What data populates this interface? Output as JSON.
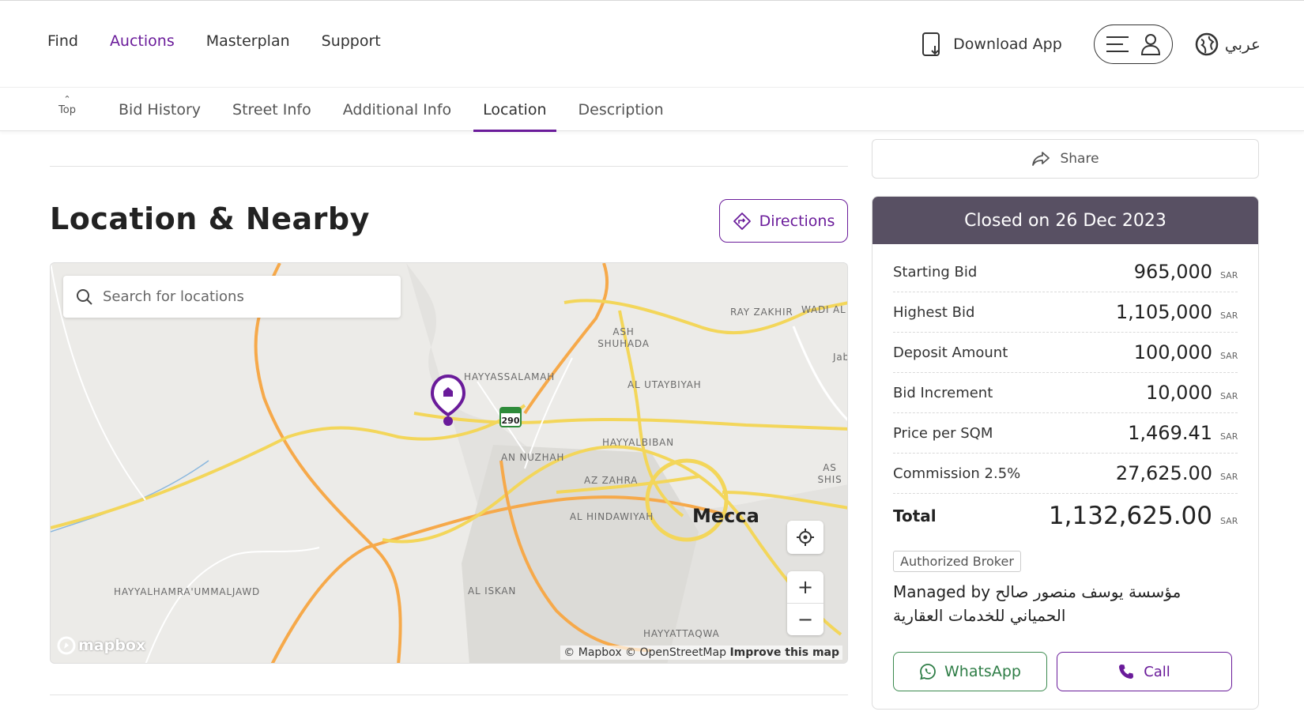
{
  "header": {
    "nav": [
      {
        "label": "Find",
        "active": false
      },
      {
        "label": "Auctions",
        "active": true
      },
      {
        "label": "Masterplan",
        "active": false
      },
      {
        "label": "Support",
        "active": false
      }
    ],
    "download_app": "Download App",
    "language": "عربي"
  },
  "subnav": {
    "top_label": "Top",
    "tabs": [
      {
        "label": "Bid History",
        "active": false
      },
      {
        "label": "Street Info",
        "active": false
      },
      {
        "label": "Additional Info",
        "active": false
      },
      {
        "label": "Location",
        "active": true
      },
      {
        "label": "Description",
        "active": false
      }
    ]
  },
  "location": {
    "title": "Location & Nearby",
    "directions_label": "Directions",
    "search_placeholder": "Search for locations",
    "map": {
      "city": "Mecca",
      "route_shield": "290",
      "labels": [
        "RAY ZAKHIR",
        "WADI AL",
        "ASH SHUHADA",
        "Jab",
        "HAYYASSALAMAH",
        "AL UTAYBIYAH",
        "HAYYALBIBAN",
        "AN NUZHAH",
        "AS SHIS",
        "AZ ZAHRA",
        "AL HINDAWIYAH",
        "HAYYALHAMRA'UMMALJAWD",
        "AL ISKAN",
        "HAYYATTAQWA"
      ],
      "logo": "mapbox",
      "attribution": "© Mapbox © OpenStreetMap",
      "improve": "Improve this map",
      "zoom_in": "+",
      "zoom_out": "−"
    }
  },
  "sidebar": {
    "share_label": "Share",
    "closed_label": "Closed on 26 Dec 2023",
    "currency": "SAR",
    "rows": [
      {
        "label": "Starting Bid",
        "value": "965,000"
      },
      {
        "label": "Highest Bid",
        "value": "1,105,000"
      },
      {
        "label": "Deposit Amount",
        "value": "100,000"
      },
      {
        "label": "Bid Increment",
        "value": "10,000"
      },
      {
        "label": "Price per SQM",
        "value": "1,469.41"
      },
      {
        "label": "Commission 2.5%",
        "value": "27,625.00"
      }
    ],
    "total": {
      "label": "Total",
      "value": "1,132,625.00"
    },
    "broker_badge": "Authorized Broker",
    "managed_by_prefix": "Managed by",
    "managed_by_name": "مؤسسة يوسف منصور صالح الحمياني للخدمات العقارية",
    "whatsapp_label": "WhatsApp",
    "call_label": "Call"
  },
  "colors": {
    "accent": "#6a1b9a",
    "header_bg": "#585063",
    "whatsapp": "#2e7d46",
    "road_major": "#f6a94a",
    "road_secondary": "#f3d65a"
  }
}
